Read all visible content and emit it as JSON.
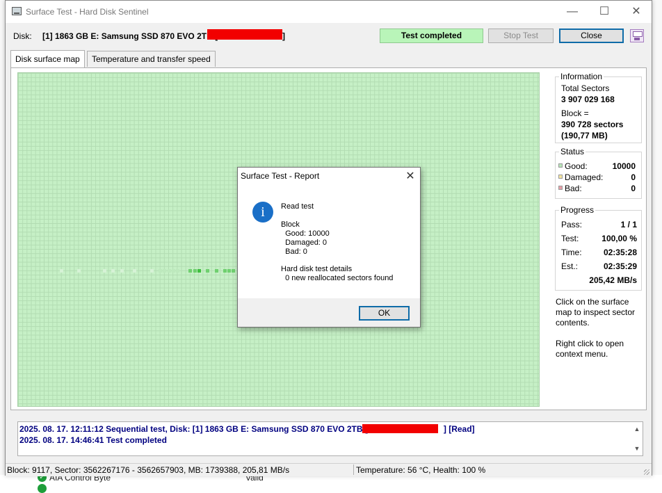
{
  "background": {
    "attribute_name": "AIA Control Byte",
    "attribute_value": "Valid"
  },
  "window": {
    "title": "Surface Test - Hard Disk Sentinel"
  },
  "header": {
    "disk_label": "Disk:",
    "disk_name": "[1] 1863 GB E: Samsung SSD 870 EVO 2TB [",
    "disk_name_end": "]",
    "status": "Test completed",
    "stop_button": "Stop Test",
    "close_button": "Close"
  },
  "tabs": [
    {
      "label": "Disk surface map",
      "active": true
    },
    {
      "label": "Temperature and transfer speed",
      "active": false
    }
  ],
  "surface_map": {
    "good_color": "#c6f0c6",
    "scan_color": "#5fcf5f"
  },
  "info": {
    "group_label": "Information",
    "total_sectors_label": "Total Sectors",
    "total_sectors_value": "3 907 029 168",
    "block_label": "Block =",
    "block_sectors": "390 728 sectors",
    "block_size": "(190,77 MB)"
  },
  "status_panel": {
    "group_label": "Status",
    "good_label": "Good:",
    "good_value": "10000",
    "damaged_label": "Damaged:",
    "damaged_value": "0",
    "bad_label": "Bad:",
    "bad_value": "0",
    "good_color": "#b8e7b8",
    "damaged_color": "#f5e6a0",
    "bad_color": "#e8a0a8"
  },
  "progress": {
    "group_label": "Progress",
    "pass_label": "Pass:",
    "pass_value": "1 / 1",
    "test_label": "Test:",
    "test_value": "100,00 %",
    "time_label": "Time:",
    "time_value": "02:35:28",
    "est_label": "Est.:",
    "est_value": "02:35:29",
    "speed": "205,42 MB/s"
  },
  "hints": {
    "click_hint": "Click on the surface map to inspect sector contents.",
    "right_click_hint": "Right click to open context menu."
  },
  "log": [
    {
      "text": "2025. 08. 17.  12:11:12   Sequential test, Disk: [1] 1863 GB E: Samsung SSD 870 EVO 2TB [",
      "suffix": "] [Read]"
    },
    {
      "text": "2025. 08. 17.  14:46:41   Test completed",
      "suffix": ""
    }
  ],
  "statusbar": {
    "block_info": "Block: 9117, Sector: 3562267176 - 3562657903, MB: 1739388, 205,81 MB/s",
    "temp_health": "Temperature: 56  °C,  Health: 100 %"
  },
  "dialog": {
    "title": "Surface Test - Report",
    "heading": "Read test",
    "block_label": "Block",
    "good": "  Good: 10000",
    "damaged": "  Damaged: 0",
    "bad": "  Bad: 0",
    "details_label": "Hard disk test details",
    "details_value": "  0 new reallocated sectors found",
    "ok_button": "OK",
    "icon": "information-icon"
  }
}
